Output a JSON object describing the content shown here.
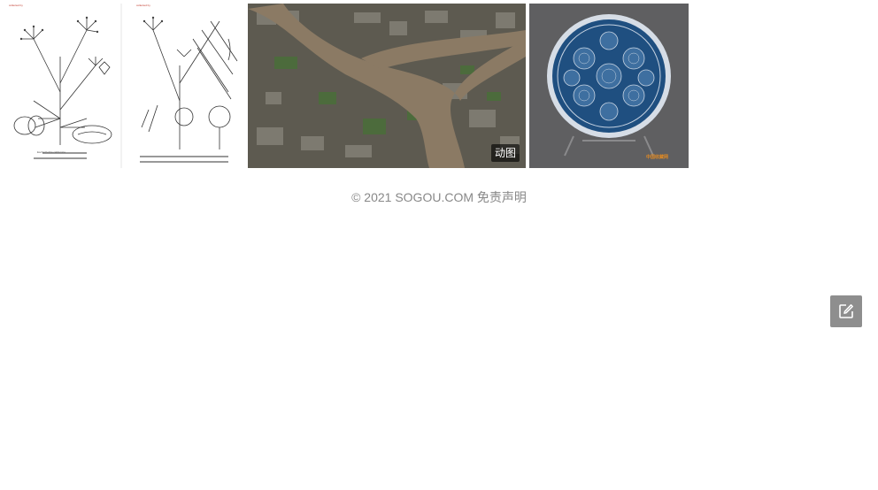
{
  "images": [
    {
      "name": "botanical-illustration",
      "captions": [
        "collected by",
        "Eschscholzia californica",
        "collected by"
      ]
    },
    {
      "name": "aerial-river-city",
      "badge": "动图"
    },
    {
      "name": "blue-white-porcelain-plate",
      "watermark": "中国收藏网"
    }
  ],
  "footer": {
    "copyright": "© 2021 SOGOU.COM",
    "disclaimer": "免责声明"
  },
  "feedback": {
    "icon": "edit-icon"
  }
}
